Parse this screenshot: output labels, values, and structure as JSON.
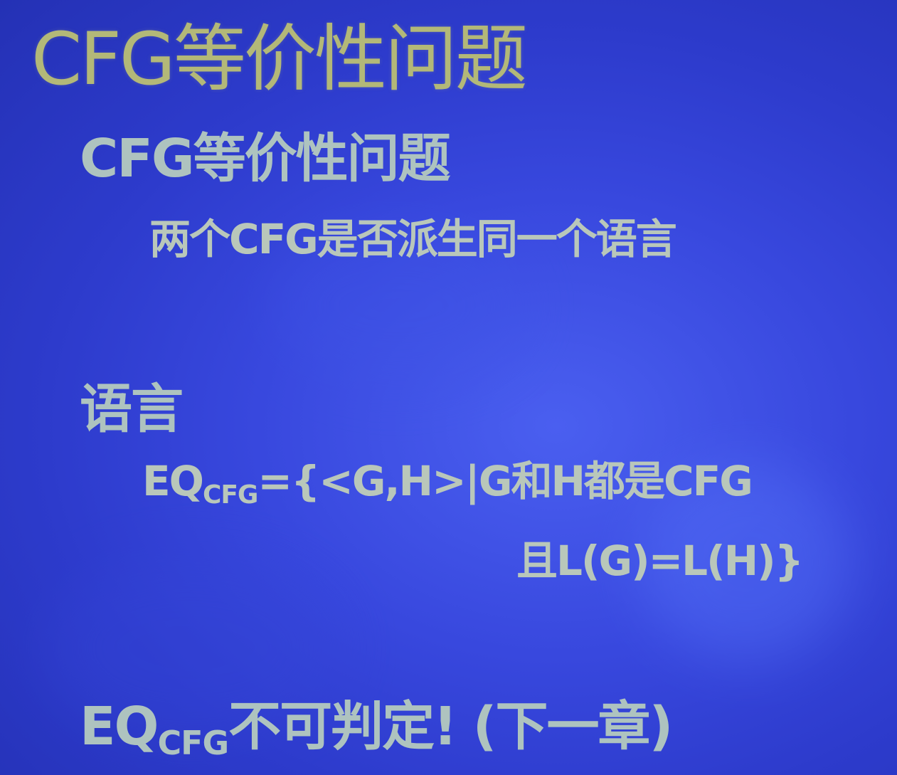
{
  "slide": {
    "title": "CFG等价性问题",
    "heading_problem": "CFG等价性问题",
    "problem_description": "两个CFG是否派生同一个语言",
    "heading_language": "语言",
    "formula": {
      "lhs_main": "EQ",
      "lhs_sub": "CFG",
      "line1_rest": "={<G,H>|G和H都是CFG",
      "line2": "且L(G)=L(H)}"
    },
    "conclusion": {
      "main": "EQ",
      "sub": "CFG",
      "rest": "不可判定! (下一章)"
    },
    "colors": {
      "background": "#3848de",
      "title": "#b3b878",
      "text": "#aec3bf"
    }
  }
}
